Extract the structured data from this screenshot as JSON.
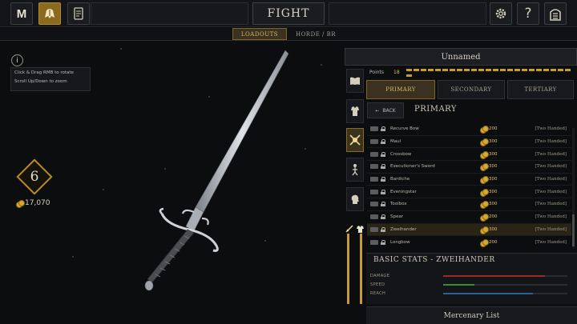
{
  "topbar": {
    "fight_label": "FIGHT",
    "icons": [
      "m-logo-icon",
      "helmet-icon",
      "scroll-icon",
      "gear-icon",
      "help-icon",
      "door-icon"
    ]
  },
  "subtabs": {
    "loadouts": "Loadouts",
    "horde": "Horde / BR"
  },
  "info": {
    "icon": "i",
    "line1": "Click & Drag RMB to rotate",
    "line2": "Scroll Up/Down to zoom"
  },
  "player": {
    "level": "6",
    "gold": "17,070"
  },
  "loadout": {
    "name": "Unnamed",
    "points_label": "Points",
    "points_value": "18",
    "tabs": [
      "Primary",
      "Secondary",
      "Tertiary"
    ],
    "back_label": "BACK",
    "section_title": "Primary"
  },
  "weapons": [
    {
      "name": "Recurve Bow",
      "cost": "200",
      "type": "[Two Handed]"
    },
    {
      "name": "Maul",
      "cost": "300",
      "type": "[Two Handed]"
    },
    {
      "name": "Crossbow",
      "cost": "300",
      "type": "[Two Handed]"
    },
    {
      "name": "Executioner's Sword",
      "cost": "300",
      "type": "[Two Handed]"
    },
    {
      "name": "Bardiche",
      "cost": "300",
      "type": "[Two Handed]"
    },
    {
      "name": "Eveningstar",
      "cost": "300",
      "type": "[Two Handed]"
    },
    {
      "name": "Toolbox",
      "cost": "300",
      "type": "[Two Handed]"
    },
    {
      "name": "Spear",
      "cost": "200",
      "type": "[Two Handed]"
    },
    {
      "name": "Zweihander",
      "cost": "300",
      "type": "[Two Handed]"
    },
    {
      "name": "Longbow",
      "cost": "200",
      "type": "[Two Handed]"
    }
  ],
  "selected_index": 8,
  "stats": {
    "title": "Basic Stats - Zweihander",
    "items": [
      {
        "label": "Damage",
        "value": 0.82,
        "color": "#9b2a26"
      },
      {
        "label": "Speed",
        "value": 0.25,
        "color": "#3a8a3a"
      },
      {
        "label": "Reach",
        "value": 0.72,
        "color": "#2d5f9b"
      }
    ]
  },
  "mercenary_label": "Mercenary List",
  "colors": {
    "accent": "#b48b2a",
    "background": "#0c0d0f"
  }
}
